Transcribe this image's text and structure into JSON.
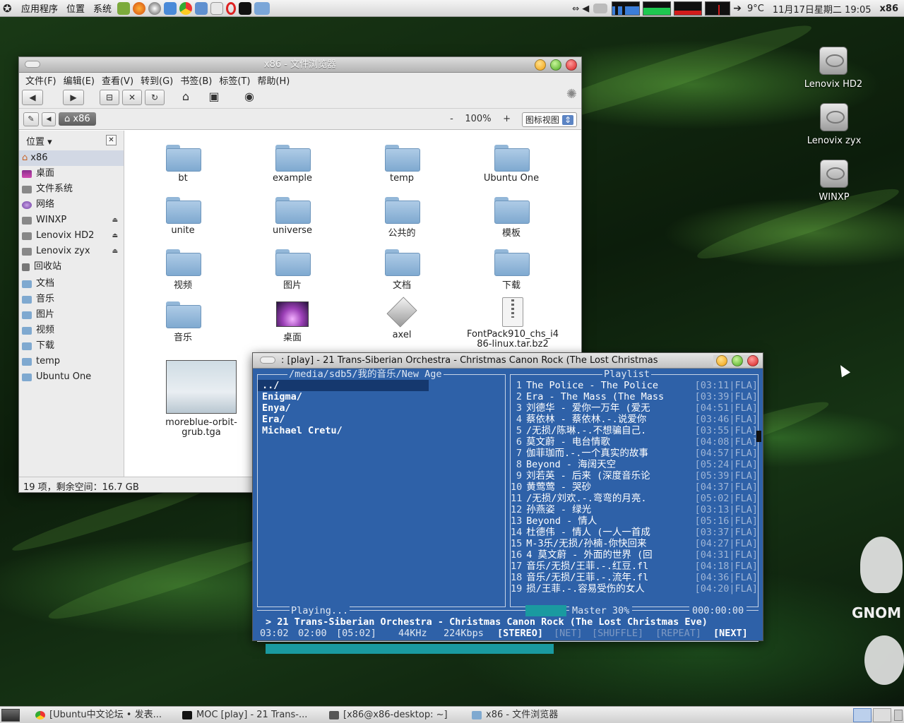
{
  "top_panel": {
    "menus": [
      "应用程序",
      "位置",
      "系统"
    ],
    "weather": "9°C",
    "clock": "11月17日星期二 19:05",
    "hostname": "x86"
  },
  "desktop_icons": [
    "Lenovix HD2",
    "Lenovix zyx",
    "WINXP"
  ],
  "file_browser": {
    "title": "x86 - 文件浏览器",
    "menus": [
      "文件(F)",
      "编辑(E)",
      "查看(V)",
      "转到(G)",
      "书签(B)",
      "标签(T)",
      "帮助(H)"
    ],
    "path_crumb": "x86",
    "zoom": "100%",
    "zoom_minus": "-",
    "zoom_plus": "+",
    "view_mode": "图标视图",
    "sidebar_heading": "位置",
    "sidebar_items": [
      "x86",
      "桌面",
      "文件系统",
      "网络",
      "WINXP",
      "Lenovix HD2",
      "Lenovix zyx",
      "回收站",
      "文档",
      "音乐",
      "图片",
      "视频",
      "下载",
      "temp",
      "Ubuntu One"
    ],
    "files": [
      "bt",
      "example",
      "temp",
      "Ubuntu One",
      "unite",
      "universe",
      "公共的",
      "模板",
      "视频",
      "图片",
      "文档",
      "下载",
      "音乐",
      "桌面",
      "axel",
      "FontPack910_chs_i486-linux.tar.bz2",
      "moreblue-orbit-grub.tga"
    ],
    "status": "19 项，剩余空间：16.7 GB"
  },
  "moc": {
    "title": ": [play] - 21 Trans-Siberian Orchestra - Christmas Canon Rock (The Lost Christmas",
    "dir_pane_title": "/media/sdb5/我的音乐/New Age",
    "dir_entries": [
      "../",
      "Enigma/",
      "Enya/",
      "Era/",
      "Michael Cretu/"
    ],
    "playlist_title": "Playlist",
    "playlist": [
      {
        "n": "1",
        "title": "The Police - The Police",
        "time": "[03:11|FLA]"
      },
      {
        "n": "2",
        "title": "Era - The Mass (The Mass",
        "time": "[03:39|FLA]"
      },
      {
        "n": "3",
        "title": "刘德华 - 爱你一万年 (爱无",
        "time": "[04:51|FLA]"
      },
      {
        "n": "4",
        "title": "蔡依林 - 蔡依林.-.说爱你",
        "time": "[03:46|FLA]"
      },
      {
        "n": "5",
        "title": "/无损/陈琳.-.不想骗自己.",
        "time": "[03:55|FLA]"
      },
      {
        "n": "6",
        "title": "莫文蔚 - 电台情歌",
        "time": "[04:08|FLA]"
      },
      {
        "n": "7",
        "title": "伽菲珈而.-.一个真实的故事",
        "time": "[04:57|FLA]"
      },
      {
        "n": "8",
        "title": "Beyond - 海阔天空",
        "time": "[05:24|FLA]"
      },
      {
        "n": "9",
        "title": "刘若英 - 后来 (深度音乐论",
        "time": "[05:39|FLA]"
      },
      {
        "n": "10",
        "title": "黄莺莺 - 哭砂",
        "time": "[04:37|FLA]"
      },
      {
        "n": "11",
        "title": "/无损/刘欢.-.弯弯的月亮.",
        "time": "[05:02|FLA]"
      },
      {
        "n": "12",
        "title": "孙燕姿 - 绿光",
        "time": "[03:13|FLA]"
      },
      {
        "n": "13",
        "title": "Beyond - 情人",
        "time": "[05:16|FLA]"
      },
      {
        "n": "14",
        "title": "杜德伟 - 情人 (一人一首成",
        "time": "[03:37|FLA]"
      },
      {
        "n": "15",
        "title": "M-3乐/无损/孙楠-你快回来",
        "time": "[04:27|FLA]"
      },
      {
        "n": "16",
        "title": "4 莫文蔚 - 外面的世界 (回",
        "time": "[04:31|FLA]"
      },
      {
        "n": "17",
        "title": "音乐/无损/王菲.-.红豆.fl",
        "time": "[04:18|FLA]"
      },
      {
        "n": "18",
        "title": "音乐/无损/王菲.-.流年.fl",
        "time": "[04:36|FLA]"
      },
      {
        "n": "19",
        "title": "损/王菲.-.容易受伤的女人",
        "time": "[04:20|FLA]"
      }
    ],
    "playing_label": "Playing...",
    "mixer": "Master  30%",
    "elapsed_total": "000:00:00",
    "now_playing": "> 21 Trans-Siberian Orchestra - Christmas Canon Rock (The Lost Christmas Eve)",
    "time_elapsed": "03:02",
    "time_left": "02:00",
    "time_total": "[05:02]",
    "rate": "44KHz",
    "bitrate": "224Kbps",
    "stereo": "[STEREO]",
    "net": "[NET]",
    "shuffle": "[SHUFFLE]",
    "repeat": "[REPEAT]",
    "next": "[NEXT]",
    "progress_fraction": 0.6
  },
  "taskbar": [
    "[Ubuntu中文论坛 • 发表...",
    "MOC [play] - 21 Trans-...",
    "[x86@x86-desktop: ~]",
    "x86 - 文件浏览器"
  ],
  "gnome_logo_text": "GNOM"
}
